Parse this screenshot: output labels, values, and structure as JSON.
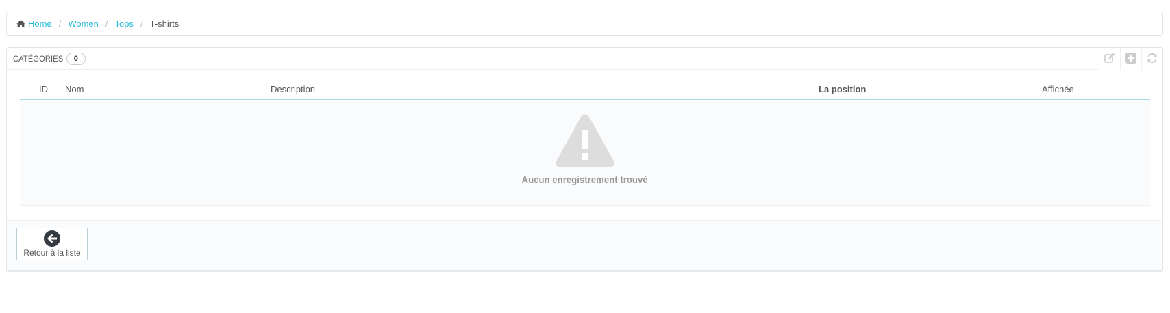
{
  "breadcrumb": {
    "items": [
      {
        "label": "Home"
      },
      {
        "label": "Women"
      },
      {
        "label": "Tops"
      }
    ],
    "current": "T-shirts",
    "separator": "/"
  },
  "panel": {
    "title": "CATÉGORIES",
    "count": "0",
    "toolbar": [
      "edit-icon",
      "add-icon",
      "refresh-icon"
    ]
  },
  "table": {
    "columns": {
      "id": "ID",
      "name": "Nom",
      "description": "Description",
      "position": "La position",
      "displayed": "Affichée"
    },
    "empty_message": "Aucun enregistrement trouvé"
  },
  "footer": {
    "back_label": "Retour à la liste"
  },
  "colors": {
    "link": "#25b9d7",
    "border": "#e3e6e9",
    "header_rule": "#a8dbe8",
    "icon_muted": "#cccccc",
    "warning_icon": "#dddddd",
    "back_icon": "#363a41"
  }
}
